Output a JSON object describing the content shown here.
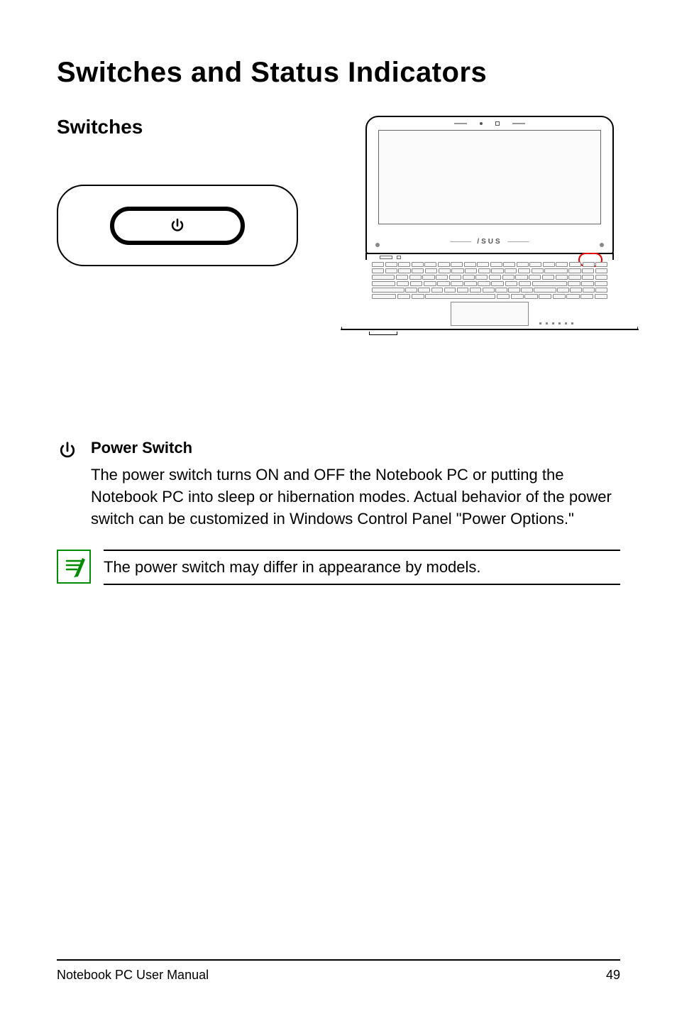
{
  "page": {
    "title": "Switches and Status Indicators",
    "section_heading": "Switches"
  },
  "power_switch": {
    "heading": "Power Switch",
    "body": "The power switch turns ON and OFF the Notebook PC or putting the Notebook PC into sleep or hibernation modes. Actual behavior of the power switch can be customized in Windows Control Panel \"Power Options.\""
  },
  "note": {
    "text": "The power switch may differ in appearance by models."
  },
  "laptop": {
    "brand": "/SUS"
  },
  "footer": {
    "left": "Notebook PC User Manual",
    "right": "49"
  }
}
